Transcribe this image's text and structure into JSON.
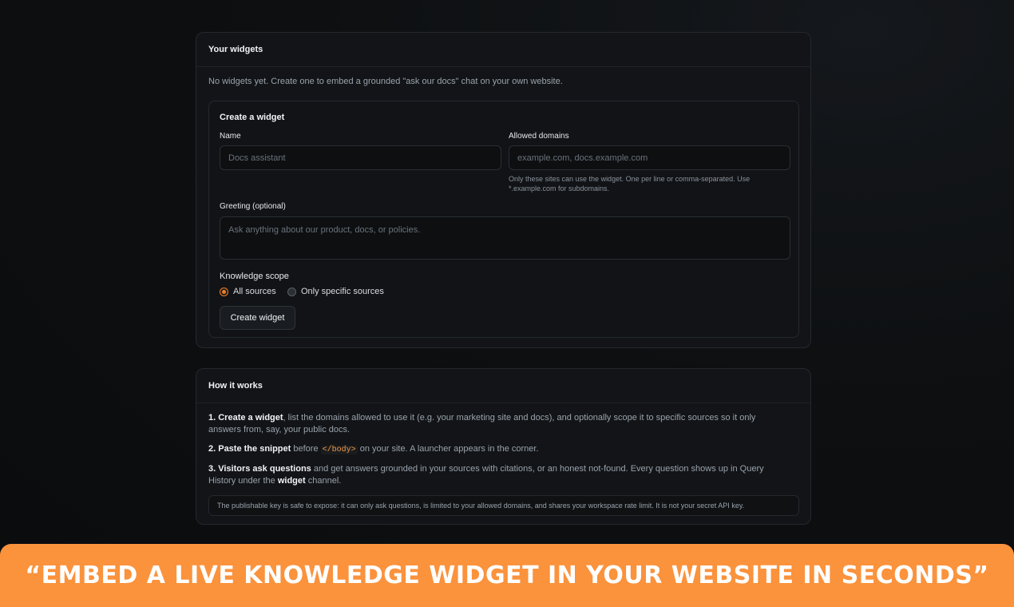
{
  "widgets_card": {
    "title": "Your widgets",
    "empty_text": "No widgets yet. Create one to embed a grounded \"ask our docs\" chat on your own website.",
    "form": {
      "title": "Create a widget",
      "name_label": "Name",
      "name_placeholder": "Docs assistant",
      "domains_label": "Allowed domains",
      "domains_placeholder": "example.com, docs.example.com",
      "domains_hint": "Only these sites can use the widget. One per line or comma-separated. Use *.example.com for subdomains.",
      "greeting_label": "Greeting (optional)",
      "greeting_placeholder": "Ask anything about our product, docs, or policies.",
      "scope_label": "Knowledge scope",
      "scope_options": [
        {
          "label": "All sources",
          "selected": true
        },
        {
          "label": "Only specific sources",
          "selected": false
        }
      ],
      "submit_label": "Create widget"
    }
  },
  "how_card": {
    "title": "How it works",
    "steps": [
      {
        "bold": "1. Create a widget",
        "text": ", list the domains allowed to use it (e.g. your marketing site and docs), and optionally scope it to specific sources so it only answers from, say, your public docs."
      },
      {
        "bold": "2. Paste the snippet",
        "pre": " before ",
        "code": "</body>",
        "post": " on your site. A launcher appears in the corner."
      },
      {
        "bold": "3. Visitors ask questions",
        "pre": " and get answers grounded in your sources with citations, or an honest not-found. Every question shows up in Query History under the ",
        "bold2": "widget",
        "post": " channel."
      }
    ],
    "note": "The publishable key is safe to expose: it can only ask questions, is limited to your allowed domains, and shares your workspace rate limit. It is not your secret API key."
  },
  "banner": {
    "text": "“EMBED A LIVE KNOWLEDGE WIDGET IN YOUR WEBSITE IN SECONDS”"
  },
  "colors": {
    "accent": "#f47e20",
    "banner_bg": "#fb923c",
    "card_bg": "#121417",
    "page_bg": "#0b0c0e"
  }
}
